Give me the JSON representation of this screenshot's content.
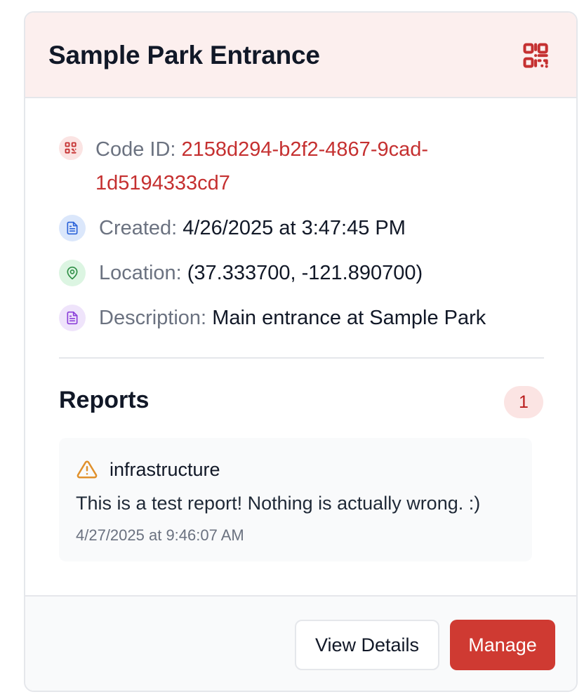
{
  "card": {
    "title": "Sample Park Entrance",
    "header_icon": "qr-code-icon",
    "accent_color": "#c53030"
  },
  "details": {
    "code_id": {
      "label": "Code ID:",
      "value_line1": "2158d294-b2f2-4867-9cad-",
      "value_line2": "1d5194333cd7",
      "icon": "qr-code-icon"
    },
    "created": {
      "label": "Created:",
      "value": "4/26/2025 at 3:47:45 PM",
      "icon": "document-icon"
    },
    "location": {
      "label": "Location:",
      "value": "(37.333700, -121.890700)",
      "icon": "map-pin-icon"
    },
    "description": {
      "label": "Description:",
      "value": "Main entrance at Sample Park",
      "icon": "document-icon"
    }
  },
  "reports": {
    "title": "Reports",
    "count": "1",
    "items": [
      {
        "category": "infrastructure",
        "message": "This is a test report! Nothing is actually wrong. :)",
        "timestamp": "4/27/2025 at 9:46:07 AM",
        "icon": "warning-icon"
      }
    ]
  },
  "footer": {
    "view_details_label": "View Details",
    "manage_label": "Manage"
  }
}
